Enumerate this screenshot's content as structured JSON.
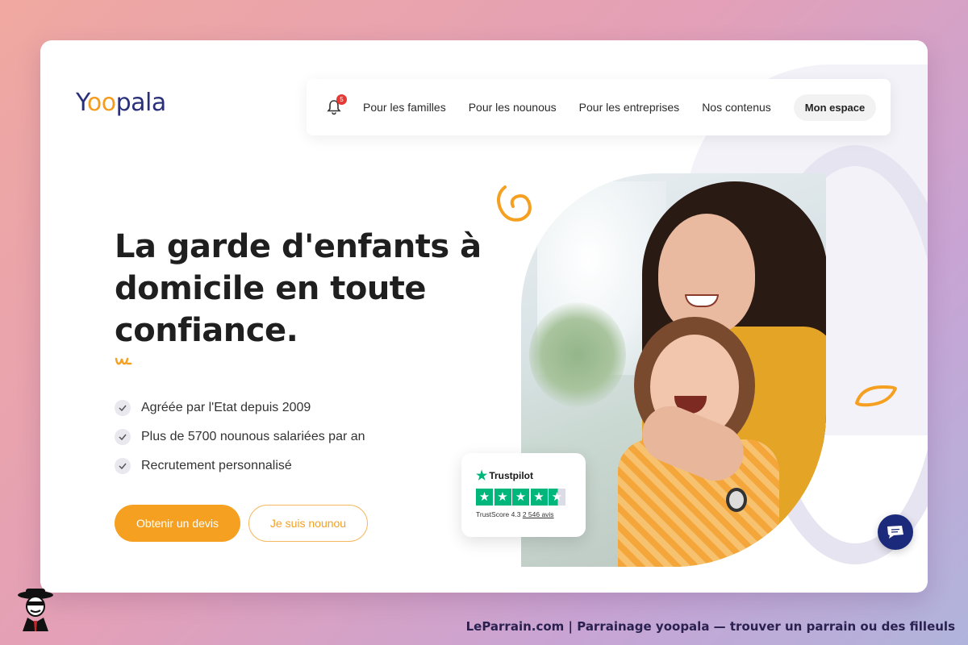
{
  "logo": {
    "text_start": "Y",
    "text_oo": "oo",
    "text_end": "pala"
  },
  "nav": {
    "badge_count": "5",
    "links": [
      "Pour les familles",
      "Pour les nounous",
      "Pour les entreprises",
      "Nos contenus"
    ],
    "account_button": "Mon espace"
  },
  "hero": {
    "headline": "La garde d'enfants à domicile en toute confiance.",
    "features": [
      "Agréée par l'Etat depuis 2009",
      "Plus de 5700 nounous salariées par an",
      "Recrutement personnalisé"
    ],
    "primary_button": "Obtenir un devis",
    "secondary_button": "Je suis nounou"
  },
  "trustpilot": {
    "brand": "Trustpilot",
    "score_label": "TrustScore 4.3",
    "reviews": "2 546 avis",
    "rating": 4.3
  },
  "footer": {
    "caption": "LeParrain.com | Parrainage yoopala — trouver un parrain ou des filleuls"
  },
  "colors": {
    "accent_orange": "#f5a020",
    "brand_navy": "#2a2f7a",
    "trustpilot_green": "#00b67a",
    "chat_navy": "#1b2a7a"
  },
  "icons": [
    "bell-icon",
    "check-icon",
    "star-icon",
    "chat-icon",
    "mascot-icon"
  ]
}
